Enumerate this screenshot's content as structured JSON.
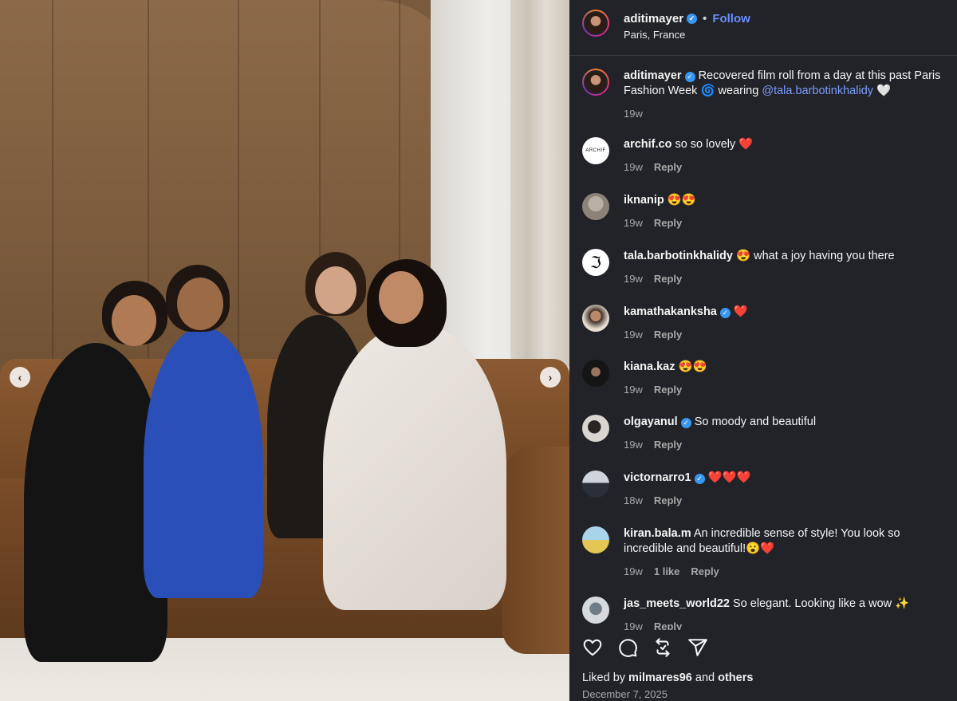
{
  "post": {
    "username": "aditimayer",
    "follow_label": "Follow",
    "location": "Paris, France",
    "caption_pre": "Recovered film roll from a day at this past Paris Fashion Week 🌀 wearing ",
    "caption_mention": "@tala.barbotinkhalidy",
    "caption_post": " 🤍",
    "caption_time": "19w"
  },
  "comments": [
    {
      "user": "archif.co",
      "verified": false,
      "text": "so so lovely ❤️",
      "time": "19w",
      "likes": "",
      "reply": "Reply",
      "avatar_text": "ARCHIF"
    },
    {
      "user": "iknanip",
      "verified": false,
      "text": "😍😍",
      "time": "19w",
      "likes": "",
      "reply": "Reply"
    },
    {
      "user": "tala.barbotinkhalidy",
      "verified": false,
      "text": "😍 what a joy having you there",
      "time": "19w",
      "likes": "",
      "reply": "Reply"
    },
    {
      "user": "kamathakanksha",
      "verified": true,
      "text": "❤️",
      "time": "19w",
      "likes": "",
      "reply": "Reply"
    },
    {
      "user": "kiana.kaz",
      "verified": false,
      "text": "😍😍",
      "time": "19w",
      "likes": "",
      "reply": "Reply"
    },
    {
      "user": "olgayanul",
      "verified": true,
      "text": "So moody and beautiful",
      "time": "19w",
      "likes": "",
      "reply": "Reply"
    },
    {
      "user": "victornarro1",
      "verified": true,
      "text": "❤️❤️❤️",
      "time": "18w",
      "likes": "",
      "reply": "Reply"
    },
    {
      "user": "kiran.bala.m",
      "verified": false,
      "text": "An incredible sense of style! You look so incredible and beautiful!😮❤️",
      "time": "19w",
      "likes": "1 like",
      "reply": "Reply"
    },
    {
      "user": "jas_meets_world22",
      "verified": false,
      "text": "So elegant. Looking like a wow ✨",
      "time": "19w",
      "likes": "",
      "reply": "Reply"
    }
  ],
  "footer": {
    "liked_by_prefix": "Liked by",
    "liked_by_user": "milmares96",
    "liked_by_and": "and",
    "liked_by_others": "others",
    "date": "December 7, 2025"
  },
  "icons": [
    "heart-icon",
    "comment-icon",
    "repost-icon",
    "share-icon",
    "chevron-left-icon",
    "chevron-right-icon",
    "verified-icon"
  ],
  "colors": {
    "panel_bg": "#212328",
    "link": "#6b8cff",
    "verified": "#3897f0"
  }
}
